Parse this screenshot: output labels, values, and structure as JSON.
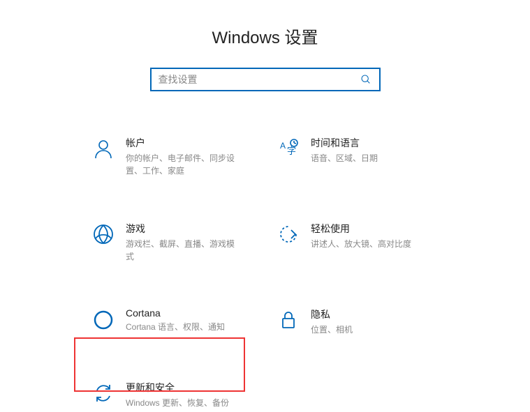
{
  "page_title": "Windows 设置",
  "search": {
    "placeholder": "查找设置"
  },
  "tiles": [
    {
      "title": "帐户",
      "desc": "你的帐户、电子邮件、同步设置、工作、家庭"
    },
    {
      "title": "时间和语言",
      "desc": "语音、区域、日期"
    },
    {
      "title": "游戏",
      "desc": "游戏栏、截屏、直播、游戏模式"
    },
    {
      "title": "轻松使用",
      "desc": "讲述人、放大镜、高对比度"
    },
    {
      "title": "Cortana",
      "desc": "Cortana 语言、权限、通知"
    },
    {
      "title": "隐私",
      "desc": "位置、相机"
    },
    {
      "title": "更新和安全",
      "desc": "Windows 更新、恢复、备份"
    }
  ]
}
